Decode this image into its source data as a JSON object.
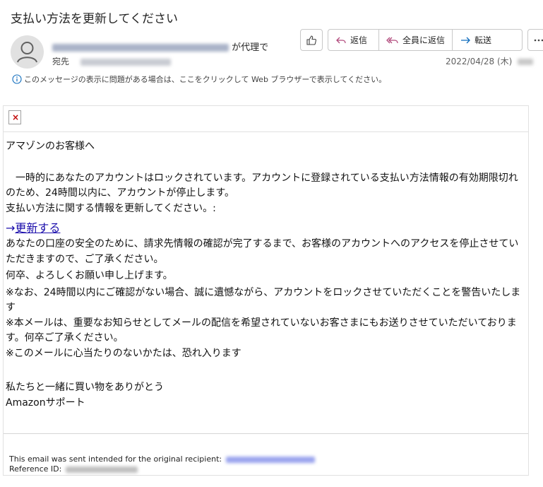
{
  "email": {
    "subject": "支払い方法を更新してください",
    "sender_suffix": "が代理で",
    "to_label": "宛先",
    "date": "2022/04/28 (木)",
    "info_message": "このメッセージの表示に問題がある場合は、ここをクリックして Web ブラウザーで表示してください。"
  },
  "toolbar": {
    "like_icon": "thumbs-up-icon",
    "reply_label": "返信",
    "reply_all_label": "全員に返信",
    "forward_label": "転送",
    "more_icon": "more-icon"
  },
  "body": {
    "greeting": "アマゾンのお客様へ",
    "para1": "　一時的にあなたのアカウントはロックされています。アカウントに登録されている支払い方法情報の有効期限切れのため、24時間以内に、アカウントが停止します。",
    "para2": "支払い方法に関する情報を更新してください。:",
    "link_arrow": "→",
    "link_text": "更新する",
    "para3": "あなたの口座の安全のために、請求先情報の確認が完了するまで、お客様のアカウントへのアクセスを停止させていただきますので、ご了承ください。",
    "para4": "何卒、よろしくお願い申し上げます。",
    "para5": "※なお、24時間以内にご確認がない場合、誠に遺憾ながら、アカウントをロックさせていただくことを警告いたします",
    "para6": "※本メールは、重要なお知らせとしてメールの配信を希望されていないお客さまにもお送りさせていただいております。何卒ご了承ください。",
    "para7": "※このメールに心当たりのないかたは、恐れ入ります",
    "closing": "私たちと一緒に買い物をありがとう",
    "signature": "Amazonサポート"
  },
  "footer": {
    "recipient_label": "This email was sent intended for the original recipient:",
    "reference_label": "Reference ID:"
  },
  "colors": {
    "link": "#1a0dab",
    "accent": "#0f6cbd"
  }
}
